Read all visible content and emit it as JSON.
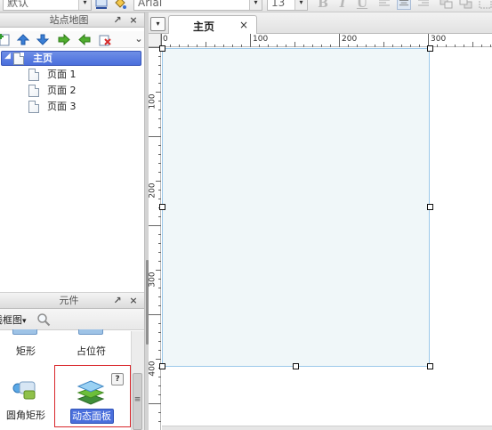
{
  "toolbar": {
    "style_select": "默认",
    "font_select": "Arial",
    "font_size": "13",
    "bold": "B",
    "italic": "I",
    "underline": "U"
  },
  "sitemap": {
    "title": "站点地图",
    "pin_glyph": "↗",
    "close_glyph": "×",
    "more_glyph": "⌄",
    "root": {
      "label": "主页",
      "expander": "◢"
    },
    "pages": [
      {
        "label": "页面 1"
      },
      {
        "label": "页面 2"
      },
      {
        "label": "页面 3"
      }
    ]
  },
  "widgets": {
    "title": "元件",
    "pin_glyph": "↗",
    "close_glyph": "×",
    "library": "线框图",
    "library_arrow": "▾",
    "items": [
      {
        "label": "矩形"
      },
      {
        "label": "占位符"
      },
      {
        "label": "圆角矩形"
      },
      {
        "label": "动态面板"
      }
    ],
    "help_badge": "?",
    "scroll_grip": "≡"
  },
  "editor": {
    "tab_menu_glyph": "▾",
    "tab_label": "主页",
    "tab_close": "×",
    "ruler_top": [
      "0",
      "100",
      "200",
      "300"
    ],
    "ruler_left": [
      "100",
      "200",
      "300",
      "400"
    ]
  },
  "colors": {
    "selection": "#4a6fdc",
    "panel_fill": "#f0f7f9",
    "panel_border": "#9cc8ea",
    "highlight_frame": "#d9272b"
  }
}
